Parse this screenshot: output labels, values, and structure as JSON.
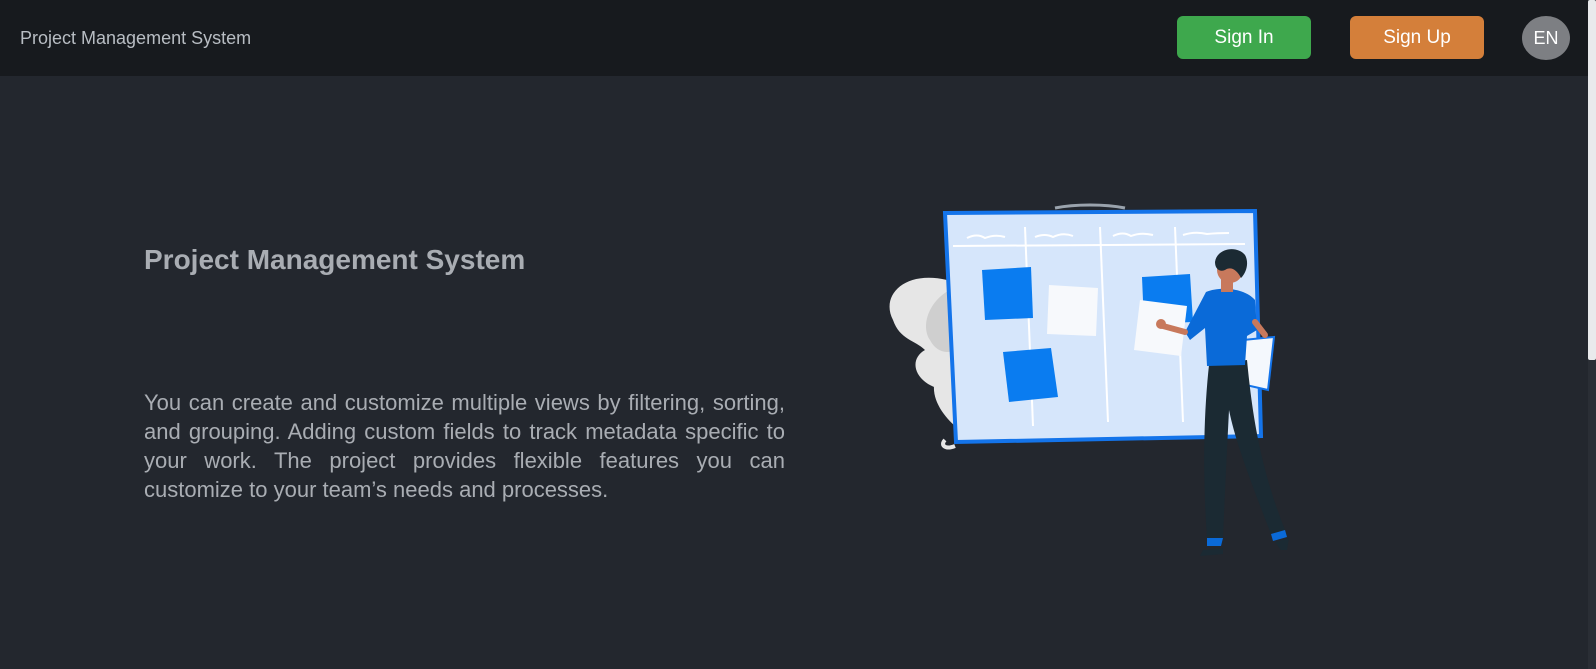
{
  "navbar": {
    "brand": "Project Management System",
    "sign_in": "Sign In",
    "sign_up": "Sign Up",
    "language": "EN"
  },
  "hero": {
    "title": "Project Management System",
    "description": "You can create and customize multiple views by filtering, sorting, and grouping. Adding custom fields to track metadata specific to your work. The project provides flexible features you can customize to your team’s needs and processes."
  },
  "colors": {
    "background": "#23272e",
    "navbar": "#171a1e",
    "sign_in": "#3ea84d",
    "sign_up": "#d47f3a",
    "accent_blue": "#0a7cf0"
  },
  "icons": {
    "illustration": "kanban-board-person-illustration"
  }
}
